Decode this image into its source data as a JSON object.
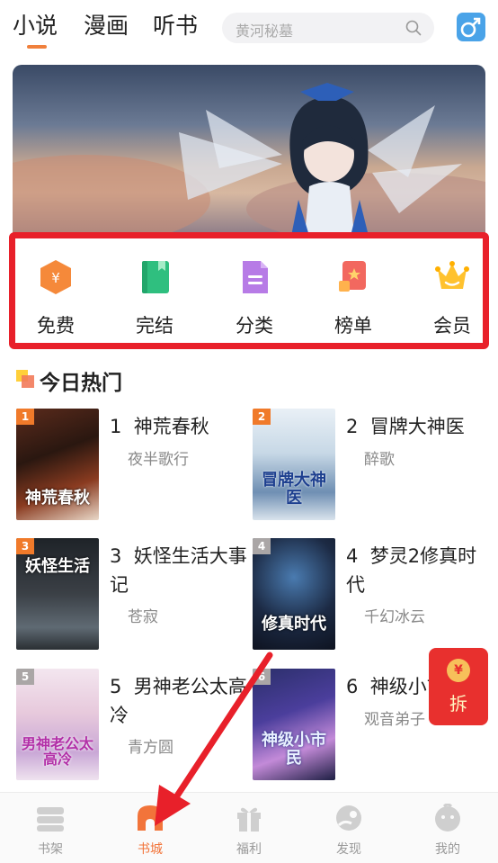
{
  "top_tabs": [
    {
      "label": "小说"
    },
    {
      "label": "漫画"
    },
    {
      "label": "听书"
    }
  ],
  "search": {
    "placeholder": "黄河秘墓"
  },
  "gender_button": {
    "symbol": "♂",
    "color": "#4aa3e8"
  },
  "quick_entries": [
    {
      "label": "免费",
      "icon": "free-coin-icon"
    },
    {
      "label": "完结",
      "icon": "book-complete-icon"
    },
    {
      "label": "分类",
      "icon": "category-doc-icon"
    },
    {
      "label": "榜单",
      "icon": "ranking-star-icon"
    },
    {
      "label": "会员",
      "icon": "vip-crown-icon"
    }
  ],
  "section": {
    "title": "今日热门"
  },
  "books": [
    {
      "rank": "1",
      "rank_label": "1",
      "name": "神荒春秋",
      "author": "夜半歌行",
      "cover_title": "神荒春秋",
      "tag_color": "#f07a2a"
    },
    {
      "rank": "2",
      "rank_label": "2",
      "name": "冒牌大神医",
      "author": "醉歌",
      "cover_title": "冒牌大神医",
      "tag_color": "#f07a2a"
    },
    {
      "rank": "3",
      "rank_label": "3",
      "name": "妖怪生活大事记",
      "author": "苍寂",
      "cover_title": "妖怪生活",
      "tag_color": "#f07a2a"
    },
    {
      "rank": "4",
      "rank_label": "4",
      "name": "梦灵2修真时代",
      "author": "千幻冰云",
      "cover_title": "修真时代",
      "tag_color": "#aaa6a6"
    },
    {
      "rank": "5",
      "rank_label": "5",
      "name": "男神老公太高冷",
      "author": "青方圆",
      "cover_title": "男神老公太高冷",
      "tag_color": "#aaa6a6"
    },
    {
      "rank": "6",
      "rank_label": "6",
      "name": "神级小市民",
      "author": "观音弟子",
      "cover_title": "神级小市民",
      "tag_color": "#aaa6a6"
    }
  ],
  "red_packet": {
    "coin": "¥",
    "label": "拆"
  },
  "bottom_nav": [
    {
      "label": "书架",
      "icon": "bookshelf-icon",
      "active": false
    },
    {
      "label": "书城",
      "icon": "bookstore-icon",
      "active": true
    },
    {
      "label": "福利",
      "icon": "gift-icon",
      "active": false
    },
    {
      "label": "发现",
      "icon": "discover-icon",
      "active": false
    },
    {
      "label": "我的",
      "icon": "profile-icon",
      "active": false
    }
  ],
  "colors": {
    "accent": "#f2743a",
    "highlight_box": "#e8202a"
  }
}
